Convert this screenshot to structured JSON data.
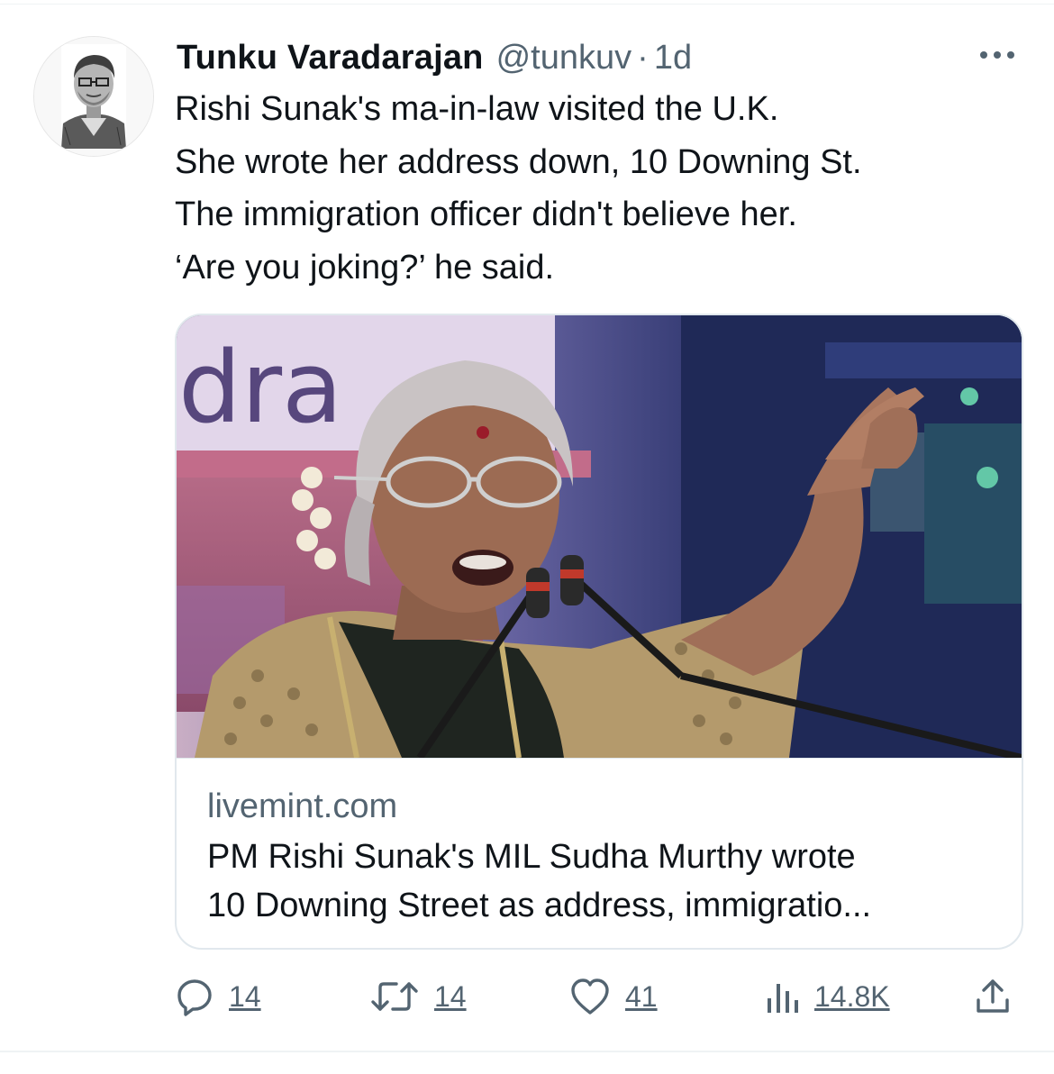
{
  "tweet": {
    "author": {
      "display_name": "Tunku  Varadarajan",
      "handle": "@tunkuv",
      "time_separator": "·",
      "time": "1d"
    },
    "text_lines": [
      "Rishi Sunak's ma-in-law visited the U.K.",
      "She wrote her address down, 10 Downing St.",
      "The immigration officer didn't believe her.",
      "‘Are you joking?’ he said."
    ],
    "card": {
      "image_overlay_text": "dra",
      "domain": "livemint.com",
      "title_lines": [
        "PM Rishi Sunak's MIL Sudha Murthy wrote",
        "10 Downing Street as address, immigratio..."
      ]
    },
    "actions": {
      "replies": "14",
      "retweets": "14",
      "likes": "41",
      "views": "14.8K"
    }
  },
  "icons": {
    "more": "more-horizontal-icon",
    "reply": "reply-icon",
    "retweet": "retweet-icon",
    "like": "heart-icon",
    "views": "bar-chart-icon",
    "share": "share-icon"
  },
  "colors": {
    "text_primary": "#0f1419",
    "text_secondary": "#536471",
    "border": "#e1e8ed"
  }
}
